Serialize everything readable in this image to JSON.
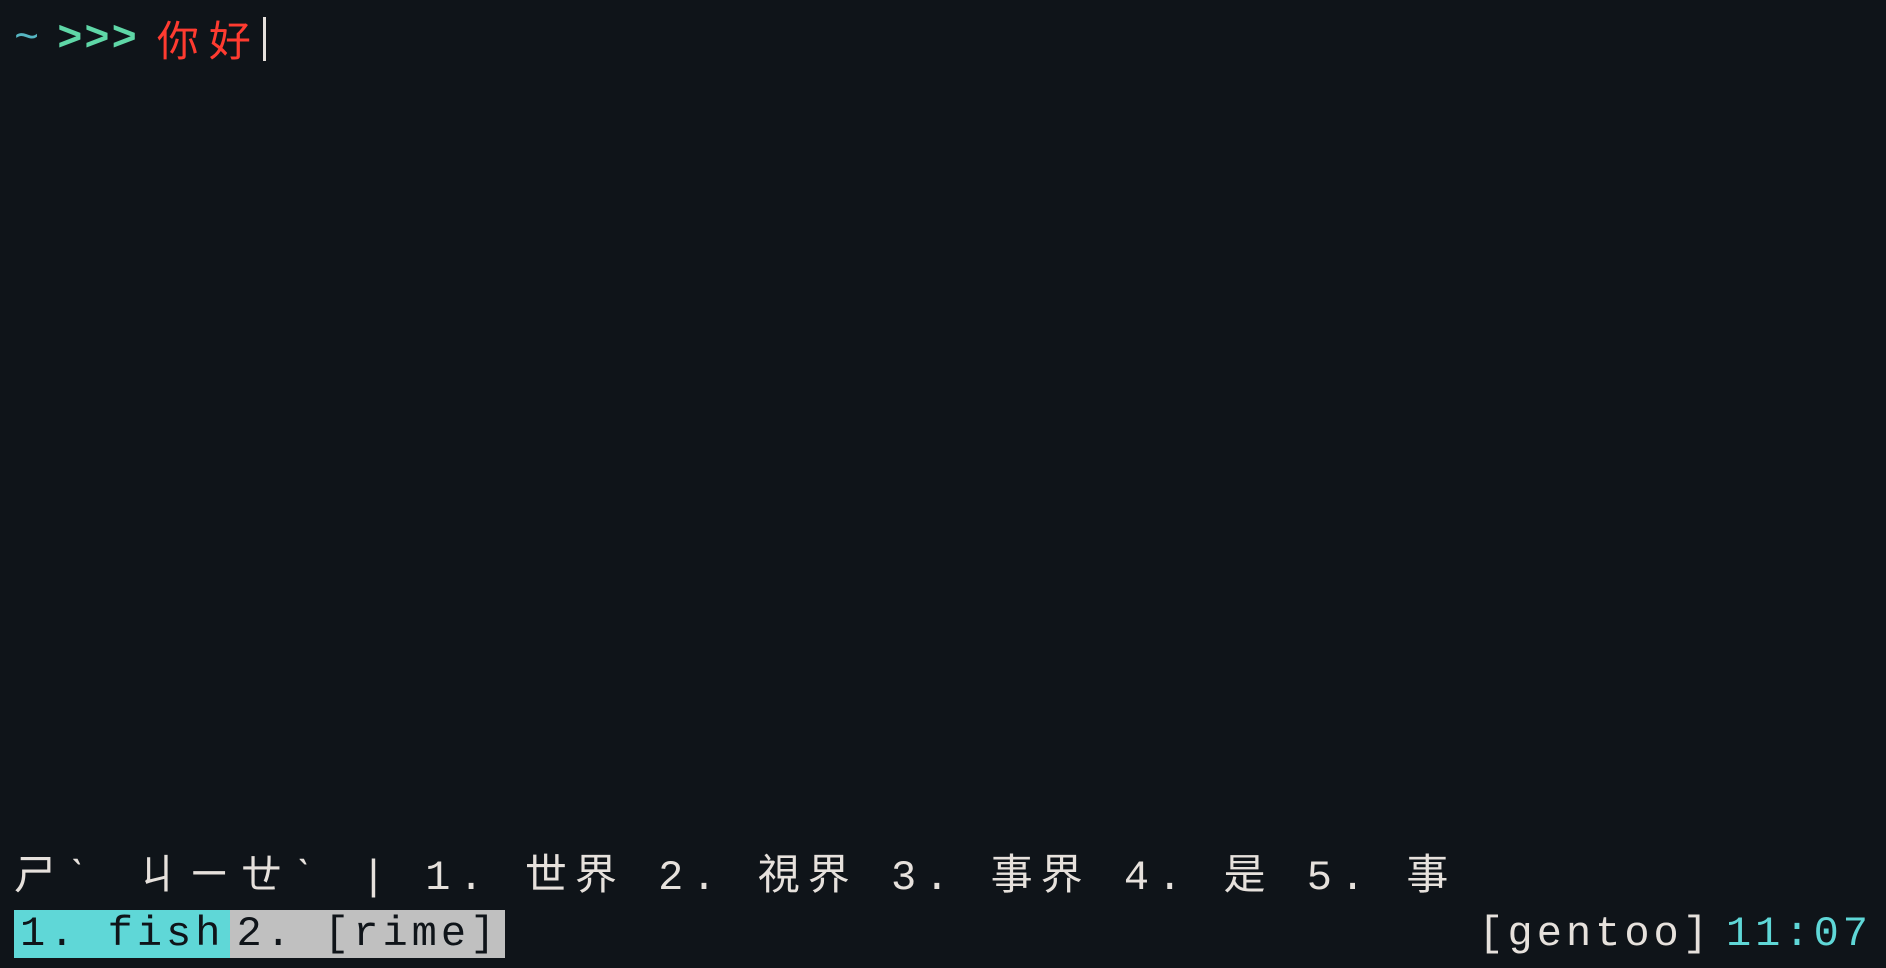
{
  "prompt": {
    "cwd": "~",
    "symbol": ">>>",
    "input": "你好"
  },
  "ime": {
    "preedit": "ㄕˋ ㄐㄧㄝˋ",
    "separator": "|",
    "candidates": [
      {
        "index": "1.",
        "text": "世界"
      },
      {
        "index": "2.",
        "text": "視界"
      },
      {
        "index": "3.",
        "text": "事界"
      },
      {
        "index": "4.",
        "text": "是"
      },
      {
        "index": "5.",
        "text": "事"
      }
    ]
  },
  "status": {
    "tabs": [
      {
        "label": "1. fish",
        "active": true
      },
      {
        "label": "2. [rime]",
        "active": false
      }
    ],
    "hostname": "[gentoo]",
    "time": "11:07"
  }
}
